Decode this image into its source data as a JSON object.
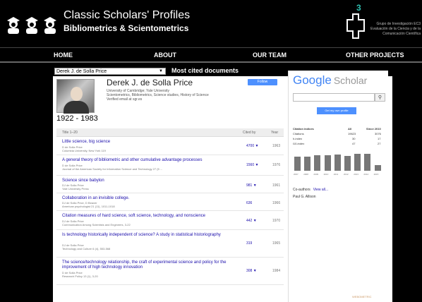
{
  "header": {
    "title": "Classic Scholars' Profiles",
    "subtitle": "Bibliometrics & Scientometrics",
    "group_number": "3",
    "group_lines": [
      "Grupo de Investigación EC3",
      "Evaluación de la Ciencia y de la",
      "Comunicación Científica"
    ]
  },
  "nav": {
    "items": [
      "HOME",
      "ABOUT",
      "OUR TEAM",
      "OTHER PROJECTS"
    ]
  },
  "toolbar": {
    "selected_scholar": "Derek J. de Solla Price",
    "most_cited": "Most cited documents"
  },
  "profile": {
    "name": "Derek J. de Solla Price",
    "affiliation": "University of Cambridge; Yale University",
    "interests": "Scientometrics, Bibliometrics, Science studies, History of Science",
    "email": "Verified email at sgr.es",
    "follow_label": "Follow",
    "years": "1922 - 1983"
  },
  "table": {
    "title_col": "Title  1–20",
    "cited_col": "Cited by",
    "year_col": "Year",
    "rows": [
      {
        "title": "Little science, big science",
        "authors": "D de Solla Price",
        "venue": "Columbia University, New York 119",
        "cites": "4700",
        "year": "1963"
      },
      {
        "title": "A general theory of bibliometric and other cumulative advantage processes",
        "authors": "D de Solla Price",
        "venue": "Journal of the American Society for Information Science and Technology 27 (5 ...",
        "cites": "1560",
        "year": "1976"
      },
      {
        "title": "Science since babylon",
        "authors": "DJ de Solla Price",
        "venue": "Yale University Press",
        "cites": "981",
        "year": "1961"
      },
      {
        "title": "Collaboration in an invisible college.",
        "authors": "DJ de Solla Price, D Beaver",
        "venue": "American psychologist 21 (11), 1011-1018",
        "cites": "636",
        "year": "1966"
      },
      {
        "title": "Citation measures of hard science, soft science, technology, and nonscience",
        "authors": "DJ de Solla Price",
        "venue": "Communication Among Scientists and Engineers, 3-22",
        "cites": "442",
        "year": "1970"
      },
      {
        "title": "Is technology historically independent of science? A study in statistical historiography",
        "authors": "DJ de Solla Price",
        "venue": "Technology and Culture 6 (4), 553-568",
        "cites": "319",
        "year": "1965"
      },
      {
        "title": "The science/technology relationship, the craft of experimental science and policy for the improvement of high technology innovation",
        "authors": "D de Solla Price",
        "venue": "Research Policy 13 (1), 3-20",
        "cites": "308",
        "year": "1984"
      }
    ]
  },
  "scholar_panel": {
    "logo_google": "Google",
    "logo_scholar": "Scholar",
    "search_icon": "search-icon",
    "get_profile": "Get my own profile",
    "citation_header": [
      "Citation indices",
      "All",
      "Since 2010"
    ],
    "citation_rows": [
      [
        "Citations",
        "19623",
        "3076"
      ],
      [
        "h-index",
        "30",
        "17"
      ],
      [
        "i10-index",
        "47",
        "27"
      ]
    ],
    "bar_values": [
      0.72,
      0.7,
      0.78,
      0.8,
      0.83,
      0.74,
      0.85,
      0.86,
      0.3
    ],
    "bar_years": [
      "2007",
      "2008",
      "2009",
      "2010",
      "2011",
      "2012",
      "2013",
      "2014",
      "2015"
    ],
    "coauthors_label": "Co-authors",
    "view_all": "View all...",
    "coauthor_name": "Paul G. Allison",
    "footer": "WEBOMETRIC"
  }
}
